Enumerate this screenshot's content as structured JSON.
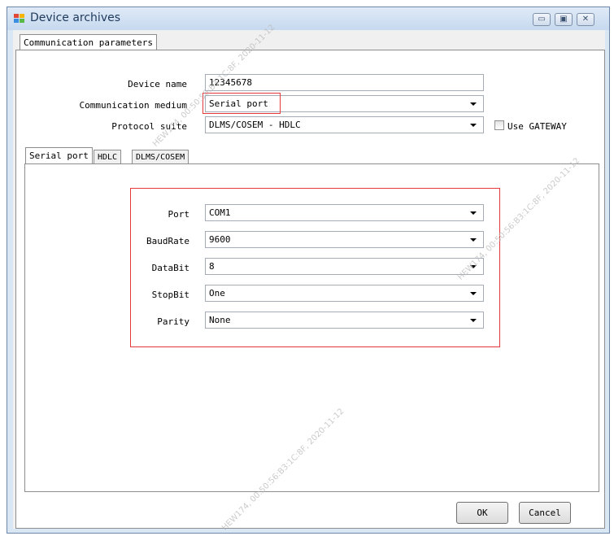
{
  "window": {
    "title": "Device archives",
    "minimize_glyph": "▭",
    "maximize_glyph": "▣",
    "close_glyph": "✕"
  },
  "outer_tab": {
    "label": "Communication parameters"
  },
  "form": {
    "device_name": {
      "label": "Device name",
      "value": "12345678"
    },
    "communication_medium": {
      "label": "Communication medium",
      "value": "Serial port"
    },
    "protocol_suite": {
      "label": "Protocol suite",
      "value": "DLMS/COSEM - HDLC"
    },
    "use_gateway": {
      "label": "Use GATEWAY",
      "checked": false
    }
  },
  "inner_tabs": [
    {
      "label": "Serial port"
    },
    {
      "label": "HDLC"
    },
    {
      "label": "DLMS/COSEM"
    }
  ],
  "serial": {
    "port": {
      "label": "Port",
      "value": "COM1"
    },
    "baudrate": {
      "label": "BaudRate",
      "value": "9600"
    },
    "databit": {
      "label": "DataBit",
      "value": "8"
    },
    "stopbit": {
      "label": "StopBit",
      "value": "One"
    },
    "parity": {
      "label": "Parity",
      "value": "None"
    }
  },
  "buttons": {
    "ok": "OK",
    "cancel": "Cancel"
  },
  "watermarks": [
    "HEW174, 00:50:56:B3:1C:8F, 2020-11-12",
    "HEW174, 00:50:56:B3:1C:8F, 2020-11-12",
    "HEW174, 00:50:56:B3:1C:8F, 2020-11-12"
  ],
  "colors": {
    "highlight": "#e5383b",
    "title_text": "#1e395b",
    "window_frame": "#d9e6f4"
  }
}
